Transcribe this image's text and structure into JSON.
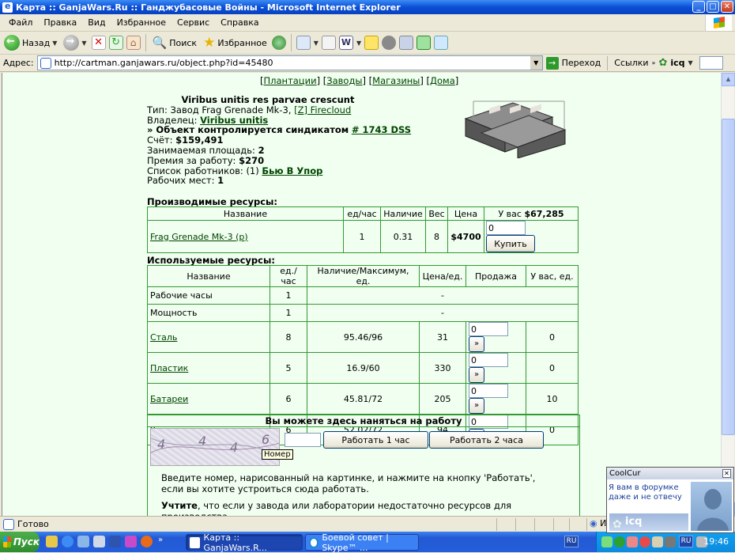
{
  "window": {
    "title": "Карта :: GanjaWars.Ru :: Ганджубасовые Войны - Microsoft Internet Explorer"
  },
  "menu": [
    "Файл",
    "Правка",
    "Вид",
    "Избранное",
    "Сервис",
    "Справка"
  ],
  "toolbar": {
    "back": "Назад",
    "search": "Поиск",
    "favorites": "Избранное"
  },
  "address": {
    "label": "Адрес:",
    "url": "http://cartman.ganjawars.ru/object.php?id=45480",
    "go": "Переход",
    "links": "Ссылки",
    "icq": "icq"
  },
  "nav": {
    "links": [
      "Плантации",
      "Заводы",
      "Магазины",
      "Дома"
    ]
  },
  "object": {
    "motto": "Viribus unitis res parvae crescunt",
    "type_label": "Тип: Завод Frag Grenade Mk-3,",
    "type_link": "[Z] Firecloud",
    "owner_label": "Владелец:",
    "owner": "Viribus unitis",
    "control_label": "» Объект контролируется синдикатом",
    "syndicate": "# 1743 DSS",
    "account_label": "Счёт:",
    "account": "$159,491",
    "area_label": "Занимаемая площадь:",
    "area": "2",
    "premium_label": "Премия за работу:",
    "premium": "$270",
    "workers_label": "Список работников: (1)",
    "worker": "Бью В Упор",
    "places_label": "Рабочих мест:",
    "places": "1"
  },
  "produced": {
    "title": "Производимые ресурсы:",
    "headers": [
      "Название",
      "ед/час",
      "Наличие",
      "Вес",
      "Цена",
      "У вас"
    ],
    "user_money": "$67,285",
    "row": {
      "name": "Frag Grenade Mk-3 (p)",
      "rate": "1",
      "stock": "0.31",
      "weight": "8",
      "price": "$4700",
      "qty": "0",
      "buy": "Купить"
    }
  },
  "used": {
    "title": "Используемые ресурсы:",
    "headers": [
      "Название",
      "ед./час",
      "Наличие/Максимум, ед.",
      "Цена/ед.",
      "Продажа",
      "У вас, ед."
    ],
    "rows": [
      {
        "name": "Рабочие часы",
        "rate": "1",
        "dash": "-"
      },
      {
        "name": "Мощность",
        "rate": "1",
        "dash": "-"
      },
      {
        "name": "Сталь",
        "rate": "8",
        "stock": "95.46/96",
        "price": "31",
        "qty": "0",
        "have": "0"
      },
      {
        "name": "Пластик",
        "rate": "5",
        "stock": "16.9/60",
        "price": "330",
        "qty": "0",
        "have": "0"
      },
      {
        "name": "Батареи",
        "rate": "6",
        "stock": "45.81/72",
        "price": "205",
        "qty": "0",
        "have": "10"
      },
      {
        "name": "Уран",
        "rate": "6",
        "stock": "52.02/72",
        "price": "94",
        "qty": "0",
        "have": "0"
      }
    ],
    "sell_btn": "»"
  },
  "work": {
    "title": "Вы можете здесь наняться на работу",
    "btn1": "Работать 1 час",
    "btn2": "Работать 2 часа",
    "tooltip": "Номер",
    "instr1": "Введите номер, нарисованный на картинке, и нажмите на кнопку 'Работать',",
    "instr2": "если вы хотите устроиться сюда работать.",
    "instr3_bold": "Учтите",
    "instr3": ", что если у завода или лаборатории недостаточно ресурсов для производства"
  },
  "status": {
    "text": "Готово",
    "zone": "И"
  },
  "taskbar": {
    "start": "Пуск",
    "tasks": [
      "Карта :: GanjaWars.R...",
      "Боевой совет | Skype™ ..."
    ],
    "lang": "RU",
    "time": "19:46"
  },
  "popup": {
    "title": "CoolCur",
    "msg": "Я вам в форумке даже и не отвечу",
    "brand": "icq"
  }
}
